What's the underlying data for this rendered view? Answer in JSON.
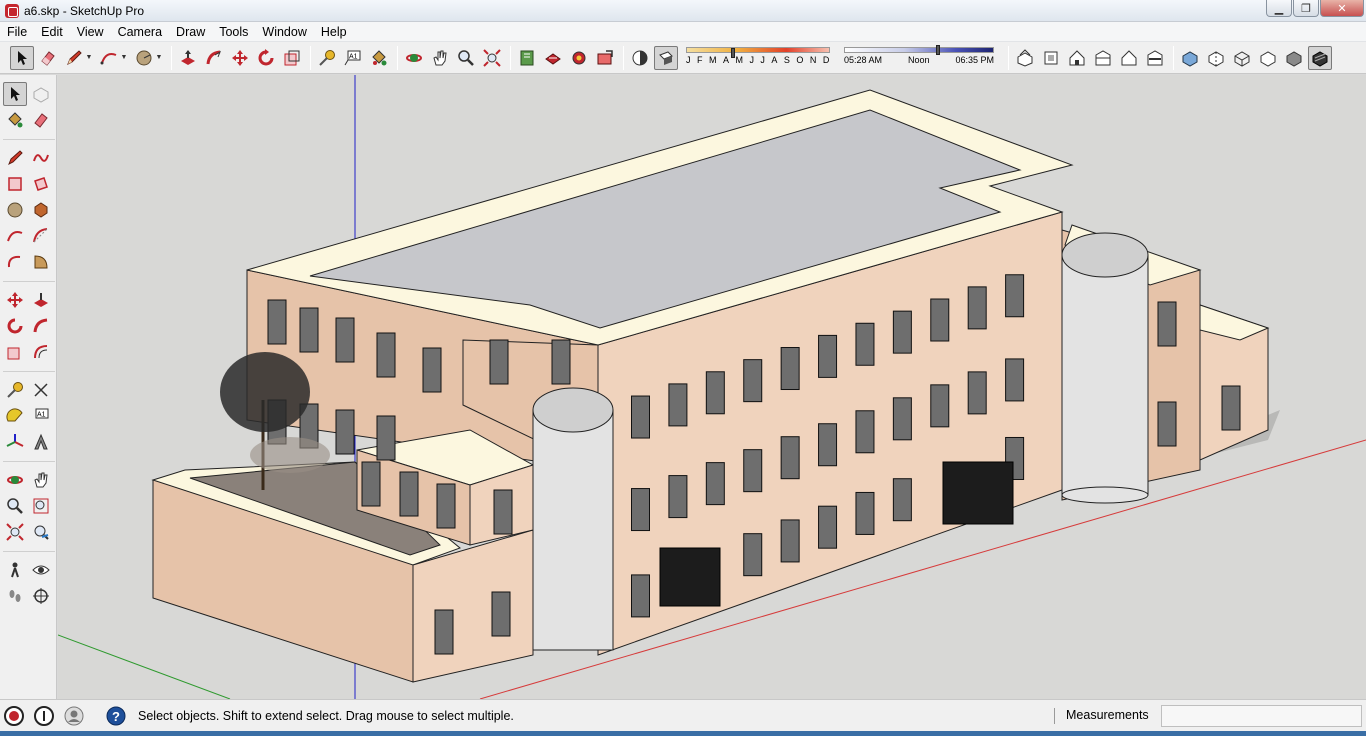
{
  "window": {
    "title": "a6.skp - SketchUp Pro",
    "minimize_glyph": "▁",
    "maximize_glyph": "❐",
    "close_glyph": "✕"
  },
  "menu": [
    "File",
    "Edit",
    "View",
    "Camera",
    "Draw",
    "Tools",
    "Window",
    "Help"
  ],
  "toolbar": {
    "shadow_months": [
      "J",
      "F",
      "M",
      "A",
      "M",
      "J",
      "J",
      "A",
      "S",
      "O",
      "N",
      "D"
    ],
    "time_start": "05:28 AM",
    "time_mid": "Noon",
    "time_end": "06:35 PM"
  },
  "status": {
    "hint": "Select objects. Shift to extend select. Drag mouse to select multiple.",
    "measurements_label": "Measurements",
    "measurements_value": ""
  },
  "colors": {
    "wall_light": "#f0d3bd",
    "wall_dark": "#e6c3a9",
    "parapet": "#fcf7df",
    "roof": "#c6c7cb",
    "cylinder": "#e3e3e3",
    "axis_red": "#d63b3b",
    "axis_green": "#2f9a2f",
    "axis_blue": "#2020c8"
  }
}
